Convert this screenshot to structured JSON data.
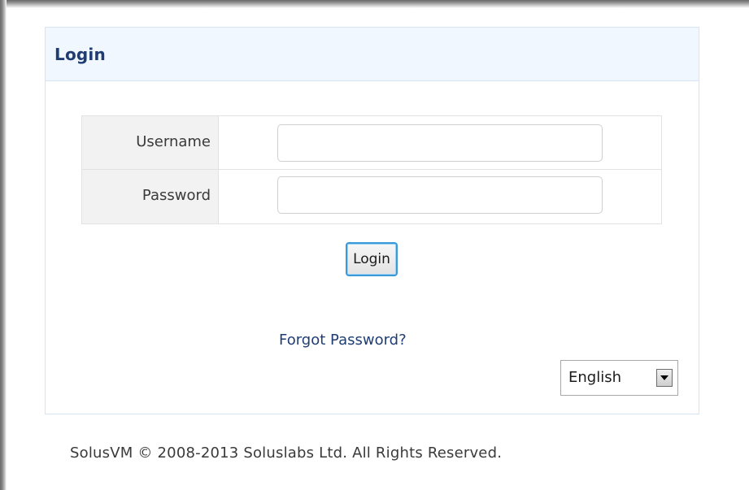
{
  "panel": {
    "title": "Login"
  },
  "form": {
    "username_label": "Username",
    "username_value": "",
    "password_label": "Password",
    "password_value": "",
    "login_button_label": "Login"
  },
  "links": {
    "forgot_password": "Forgot Password?"
  },
  "language": {
    "selected": "English"
  },
  "footer": {
    "text": "SolusVM © 2008-2013 Soluslabs Ltd. All Rights Reserved."
  },
  "colors": {
    "title": "#1f3d73",
    "header_bg": "#f1f7fe",
    "button_border": "#3a9ad9"
  },
  "icons": {
    "dropdown": "chevron-down-icon"
  }
}
